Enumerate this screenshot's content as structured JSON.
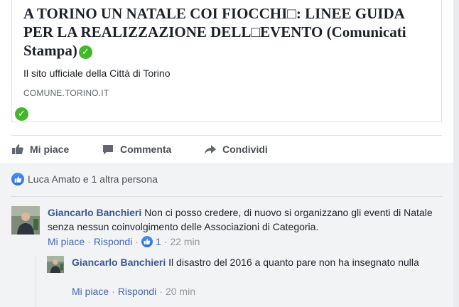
{
  "link_preview": {
    "title": "A TORINO UN NATALE COI FIOCCHI□: LINEE GUIDA PER LA REALIZZAZIONE DELL□EVENTO (Comunicati Stampa)",
    "description": "Il sito ufficiale della Città di Torino",
    "domain": "COMUNE.TORINO.IT"
  },
  "actions": {
    "like": "Mi piace",
    "comment": "Commenta",
    "share": "Condividi"
  },
  "reactions_summary": "Luca Amato e 1 altra persona",
  "comments": [
    {
      "author": "Giancarlo Banchieri",
      "text": "Non ci posso credere, di nuovo si organizzano gli eventi di Natale senza nessun coinvolgimento delle Associazioni di Categoria.",
      "like_label": "Mi piace",
      "reply_label": "Rispondi",
      "like_count": "1",
      "time": "22 min"
    },
    {
      "author": "Giancarlo Banchieri",
      "text": "Il disastro del 2016 a quanto pare non ha insegnato nulla",
      "like_label": "Mi piace",
      "reply_label": "Rispondi",
      "time": "20 min"
    }
  ],
  "colors": {
    "link": "#385898",
    "accent_blue": "#4267b2",
    "verified_green": "#42b72a"
  }
}
